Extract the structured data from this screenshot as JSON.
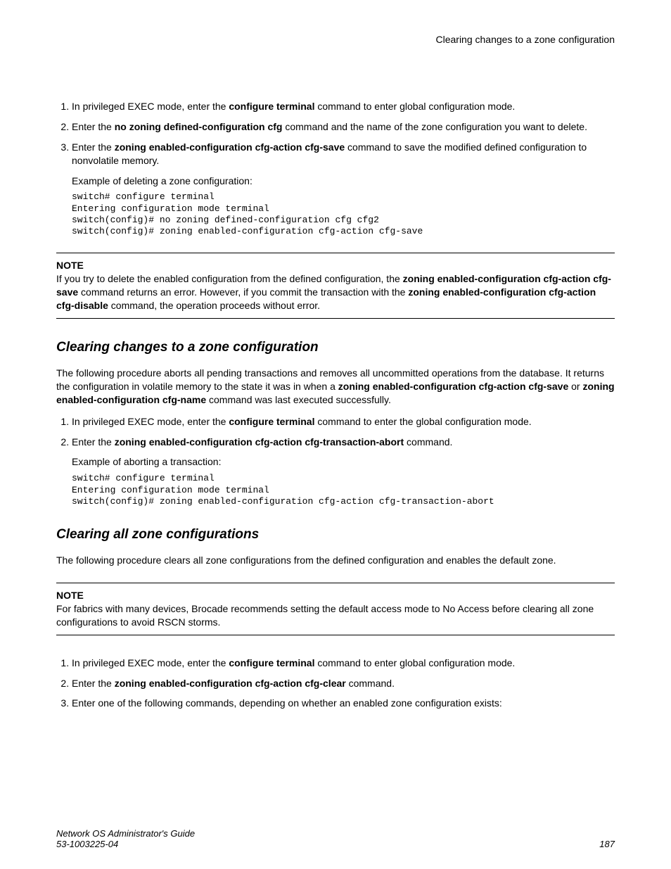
{
  "header": {
    "running_head": "Clearing changes to a zone configuration"
  },
  "section_a": {
    "steps": [
      {
        "pre": "In privileged EXEC mode, enter the ",
        "bold1": "configure terminal",
        "post": " command to enter global configuration mode."
      },
      {
        "pre": "Enter the ",
        "bold1": "no zoning defined-configuration cfg",
        "post": " command and the name of the zone configuration you want to delete."
      },
      {
        "pre": "Enter the ",
        "bold1": "zoning enabled-configuration cfg-action cfg-save",
        "post": " command to save the modified defined configuration to nonvolatile memory."
      }
    ],
    "example_label": "Example of deleting a zone configuration:",
    "code": "switch# configure terminal\nEntering configuration mode terminal\nswitch(config)# no zoning defined-configuration cfg cfg2\nswitch(config)# zoning enabled-configuration cfg-action cfg-save"
  },
  "note1": {
    "label": "NOTE",
    "t1": "If you try to delete the enabled configuration from the defined configuration, the ",
    "b1": "zoning enabled-configuration cfg-action cfg-save",
    "t2": " command returns an error. However, if you commit the transaction with the ",
    "b2": "zoning enabled-configuration cfg-action cfg-disable",
    "t3": " command, the operation proceeds without error."
  },
  "section_b": {
    "title": "Clearing changes to a zone configuration",
    "intro": {
      "t1": "The following procedure aborts all pending transactions and removes all uncommitted operations from the database. It returns the configuration in volatile memory to the state it was in when a ",
      "b1": "zoning enabled-configuration cfg-action cfg-save",
      "t2": " or ",
      "b2": "zoning enabled-configuration cfg-name",
      "t3": " command was last executed successfully."
    },
    "steps": [
      {
        "pre": "In privileged EXEC mode, enter the ",
        "bold1": "configure terminal",
        "post": " command to enter the global configuration mode."
      },
      {
        "pre": "Enter the ",
        "bold1": "zoning enabled-configuration cfg-action cfg-transaction-abort",
        "post": " command."
      }
    ],
    "example_label": "Example of aborting a transaction:",
    "code": "switch# configure terminal\nEntering configuration mode terminal\nswitch(config)# zoning enabled-configuration cfg-action cfg-transaction-abort"
  },
  "section_c": {
    "title": "Clearing all zone configurations",
    "intro": "The following procedure clears all zone configurations from the defined configuration and enables the default zone.",
    "note": {
      "label": "NOTE",
      "text": "For fabrics with many devices, Brocade recommends setting the default access mode to No Access before clearing all zone configurations to avoid RSCN storms."
    },
    "steps": [
      {
        "pre": "In privileged EXEC mode, enter the ",
        "bold1": "configure terminal",
        "post": " command to enter global configuration mode."
      },
      {
        "pre": "Enter the ",
        "bold1": "zoning enabled-configuration cfg-action cfg-clear",
        "post": " command."
      },
      {
        "pre": "Enter one of the following commands, depending on whether an enabled zone configuration exists:",
        "bold1": "",
        "post": ""
      }
    ]
  },
  "footer": {
    "guide": "Network OS Administrator's Guide",
    "docnum": "53-1003225-04",
    "page": "187"
  }
}
